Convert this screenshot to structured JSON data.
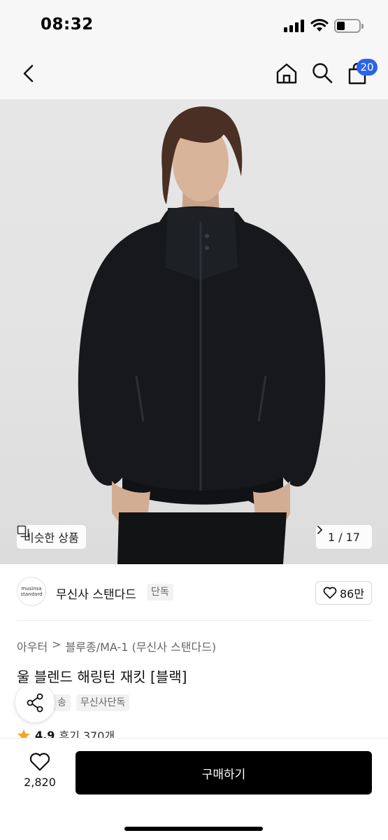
{
  "status": {
    "time": "08:32"
  },
  "nav": {
    "cart_count": "20"
  },
  "gallery": {
    "similar_label": "비슷한 상품",
    "page_indicator": "1 / 17"
  },
  "brand": {
    "logo_line1": "musinsa",
    "logo_line2": "standard",
    "name": "무신사 스탠다드",
    "tag": "단독",
    "likes": "86만"
  },
  "product": {
    "breadcrumb": [
      "아우터",
      "블루종/MA-1 (무신사 스탠다드)"
    ],
    "title": "울 블렌드 해링턴 재킷 [블랙]",
    "tags": [
      "송",
      "무신사단독"
    ],
    "rating": "4.9",
    "reviews": "후기 370개"
  },
  "bottom": {
    "wish_count": "2,820",
    "buy_label": "구매하기"
  },
  "colors": {
    "accent_badge": "#2b63ea",
    "buy_button": "#000000",
    "star": "#f5a623"
  }
}
